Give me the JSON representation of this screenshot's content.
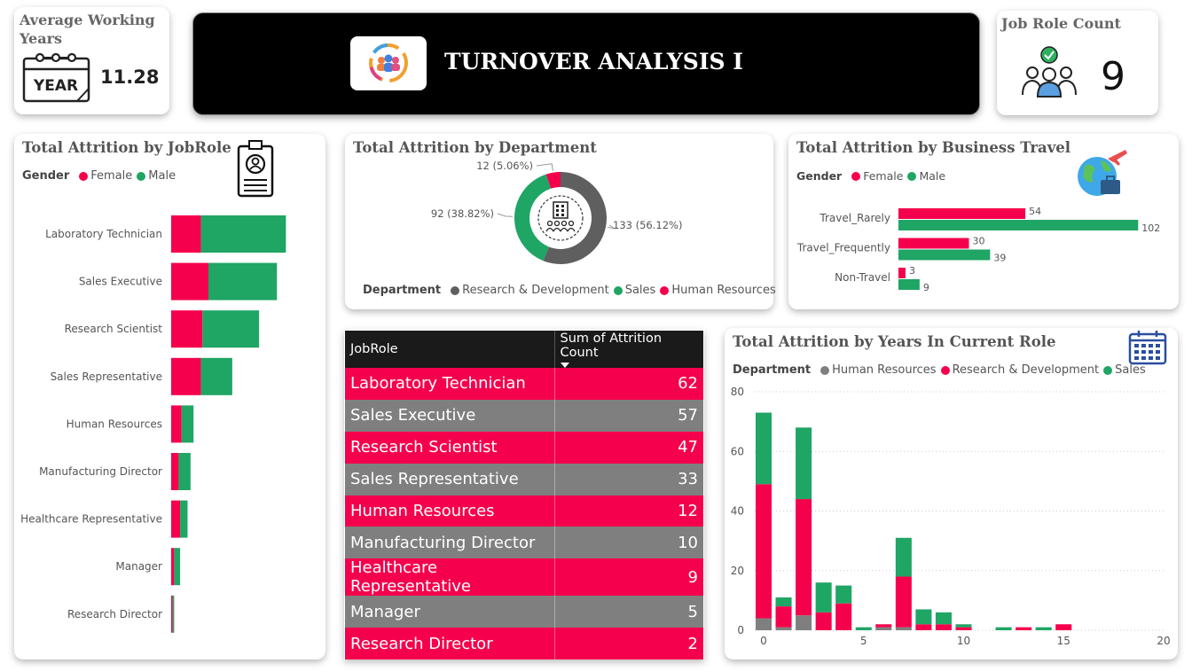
{
  "colors": {
    "female": "#f5004c",
    "male": "#1fa564",
    "hr": "#7f7f7f",
    "rnd": "#f5004c",
    "sales": "#1fa564",
    "dept_rnd": "#5f5f5f"
  },
  "kpi_working_years": {
    "title": "Average Working Years",
    "icon_label": "YEAR",
    "value": "11.28"
  },
  "header": {
    "title": "TURNOVER ANALYSIS I"
  },
  "kpi_jobrole": {
    "title": "Job Role Count",
    "value": "9"
  },
  "chart_data": [
    {
      "id": "jobrole",
      "type": "bar",
      "orientation": "horizontal",
      "stacked": true,
      "title": "Total Attrition by JobRole",
      "legend_title": "Gender",
      "categories": [
        "Laboratory Technician",
        "Sales Executive",
        "Research Scientist",
        "Sales Representative",
        "Human Resources",
        "Manufacturing Director",
        "Healthcare Representative",
        "Manager",
        "Research Director"
      ],
      "series": [
        {
          "name": "Female",
          "values": [
            20,
            25,
            21,
            20,
            7,
            5,
            6,
            2,
            1
          ]
        },
        {
          "name": "Male",
          "values": [
            57,
            46,
            38,
            21,
            8,
            8,
            5,
            4,
            1
          ]
        }
      ]
    },
    {
      "id": "department",
      "type": "pie",
      "donut": true,
      "title": "Total Attrition by Department",
      "legend_title": "Department",
      "slices": [
        {
          "name": "Research & Development",
          "value": 133,
          "label": "133 (56.12%)"
        },
        {
          "name": "Sales",
          "value": 92,
          "label": "92 (38.82%)"
        },
        {
          "name": "Human Resources",
          "value": 12,
          "label": "12 (5.06%)"
        }
      ]
    },
    {
      "id": "travel",
      "type": "bar",
      "orientation": "horizontal",
      "title": "Total Attrition by Business Travel",
      "legend_title": "Gender",
      "categories": [
        "Travel_Rarely",
        "Travel_Frequently",
        "Non-Travel"
      ],
      "series": [
        {
          "name": "Female",
          "values": [
            54,
            30,
            3
          ]
        },
        {
          "name": "Male",
          "values": [
            102,
            39,
            9
          ]
        }
      ]
    },
    {
      "id": "jobrole_table",
      "type": "table",
      "columns": [
        "JobRole",
        "Sum of Attrition Count"
      ],
      "rows": [
        [
          "Laboratory Technician",
          "62"
        ],
        [
          "Sales Executive",
          "57"
        ],
        [
          "Research Scientist",
          "47"
        ],
        [
          "Sales Representative",
          "33"
        ],
        [
          "Human Resources",
          "12"
        ],
        [
          "Manufacturing Director",
          "10"
        ],
        [
          "Healthcare Representative",
          "9"
        ],
        [
          "Manager",
          "5"
        ],
        [
          "Research Director",
          "2"
        ]
      ]
    },
    {
      "id": "years_role",
      "type": "bar",
      "stacked": true,
      "title": "Total Attrition by Years In Current Role",
      "legend_title": "Department",
      "x": [
        0,
        1,
        2,
        3,
        4,
        5,
        6,
        7,
        8,
        9,
        10,
        12,
        13,
        14,
        15
      ],
      "series": [
        {
          "name": "Human Resources",
          "values": [
            4,
            1,
            5,
            0,
            0,
            0,
            1,
            1,
            0,
            0,
            0,
            0,
            0,
            0,
            0
          ]
        },
        {
          "name": "Research & Development",
          "values": [
            45,
            7,
            39,
            6,
            9,
            0,
            1,
            17,
            2,
            2,
            1,
            0,
            1,
            0,
            2
          ]
        },
        {
          "name": "Sales",
          "values": [
            24,
            3,
            24,
            10,
            6,
            1,
            0,
            13,
            5,
            4,
            1,
            1,
            0,
            1,
            0
          ]
        }
      ],
      "xlim": [
        0,
        20
      ],
      "ylim": [
        0,
        80
      ],
      "x_ticks": [
        "0",
        "5",
        "10",
        "15",
        "20"
      ],
      "y_ticks": [
        "0",
        "20",
        "40",
        "60",
        "80"
      ]
    }
  ]
}
